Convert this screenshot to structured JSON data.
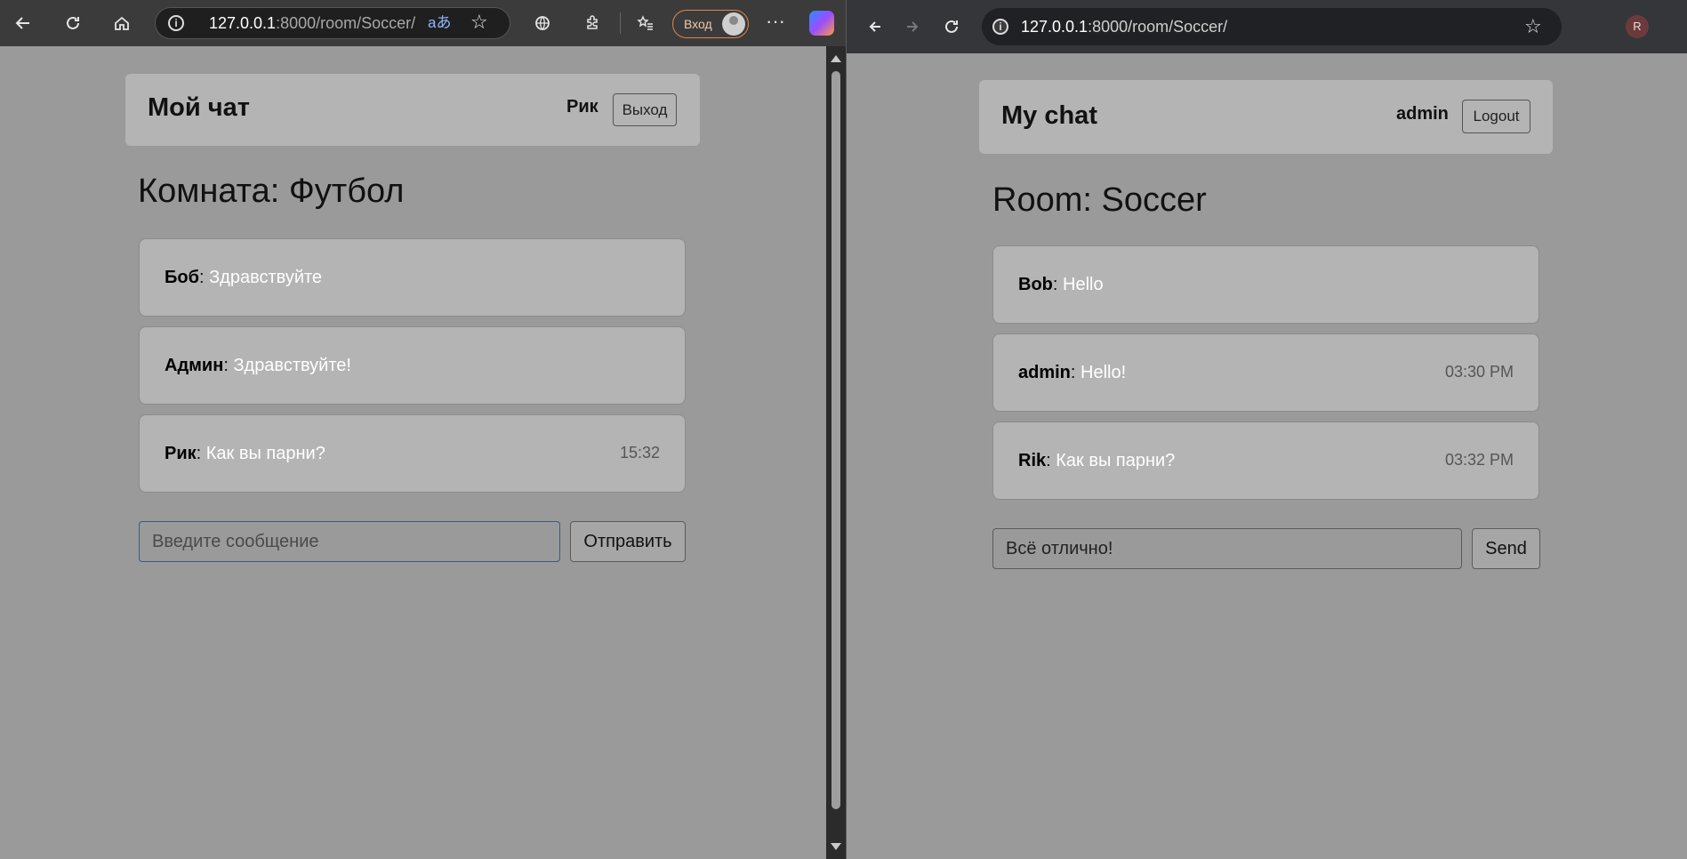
{
  "left_browser": {
    "url_host": "127.0.0.1",
    "url_rest": ":8000/room/Soccer/",
    "signin_label": "Вход",
    "app": {
      "brand": "Мой чат",
      "username": "Рик",
      "logout_label": "Выход",
      "room_title": "Комната: Футбол",
      "messages": [
        {
          "author": "Боб",
          "text": "Здравствуйте",
          "time": ""
        },
        {
          "author": "Админ",
          "text": "Здравствуйте!",
          "time": ""
        },
        {
          "author": "Рик",
          "text": "Как вы парни?",
          "time": "15:32"
        }
      ],
      "input_placeholder": "Введите сообщение",
      "input_value": "",
      "send_label": "Отправить"
    }
  },
  "right_browser": {
    "url_host": "127.0.0.1",
    "url_rest": ":8000/room/Soccer/",
    "profile_initial": "R",
    "app": {
      "brand": "My chat",
      "username": "admin",
      "logout_label": "Logout",
      "room_title": "Room: Soccer",
      "messages": [
        {
          "author": "Bob",
          "text": "Hello",
          "time": ""
        },
        {
          "author": "admin",
          "text": "Hello!",
          "time": "03:30 PM"
        },
        {
          "author": "Rik",
          "text": "Как вы парни?",
          "time": "03:32 PM"
        }
      ],
      "input_placeholder": "",
      "input_value": "Всё отлично!",
      "send_label": "Send"
    }
  },
  "colors": {
    "page_bg": "#9a9a9a",
    "card_bg": "#b4b4b4",
    "message_text": "#ffffff",
    "signin_accent": "#d8894f"
  }
}
